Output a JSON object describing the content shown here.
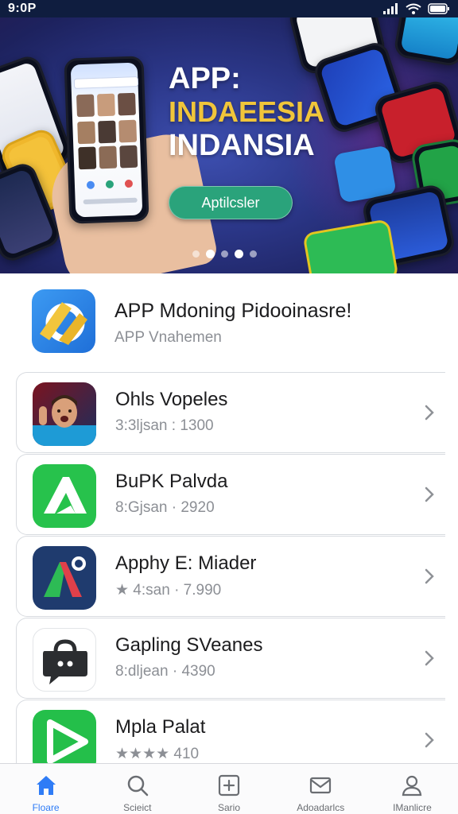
{
  "status_bar": {
    "time": "9:0P"
  },
  "hero": {
    "title_line1": "APP:",
    "title_line2": "INDAEESIA",
    "title_line3": "INDANSIA",
    "cta_label": "Aptilcsler",
    "page_dots": 5,
    "active_dot": 3
  },
  "featured": {
    "name": "APP Mdoning Pidooinasre!",
    "subtitle": "APP Vnahemen"
  },
  "apps": [
    {
      "name": "Ohls Vopeles",
      "meta": "3:3ljsan : 1300"
    },
    {
      "name": "BuPK Palvda",
      "meta": "8:Gjsan · 2920"
    },
    {
      "name": "Apphy E: Miader",
      "meta": "★ 4:san · 7.990"
    },
    {
      "name": "Gapling SVeanes",
      "meta": "8:dljean · 4390"
    },
    {
      "name": "Mpla Palat",
      "meta": "★★★★ 410"
    }
  ],
  "nav": [
    {
      "label": "Floare",
      "icon": "home-icon",
      "active": true
    },
    {
      "label": "Scieict",
      "icon": "search-icon",
      "active": false
    },
    {
      "label": "Sario",
      "icon": "add-icon",
      "active": false
    },
    {
      "label": "Adoadarlcs",
      "icon": "mail-icon",
      "active": false
    },
    {
      "label": "IManlicre",
      "icon": "profile-icon",
      "active": false
    }
  ],
  "colors": {
    "accent": "#2f7cf6",
    "cta": "#2aa37b",
    "title_gold": "#f0c53a",
    "hero_bg": "#2a3585"
  }
}
